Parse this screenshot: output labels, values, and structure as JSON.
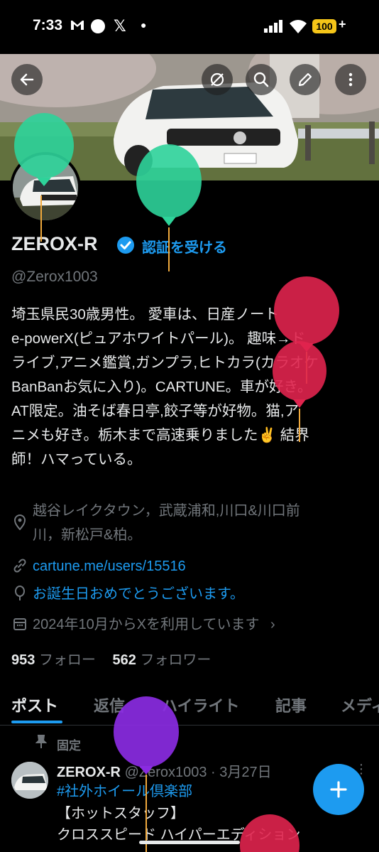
{
  "status_bar": {
    "time": "7:33",
    "battery": "100",
    "battery_plus": "+"
  },
  "profile": {
    "name": "ZEROX-R",
    "verify_cta": "認証を受ける",
    "handle": "@Zerox1003",
    "bio_lines": [
      "埼玉県民30歳男性。 愛車は、日産ノート",
      "e-powerX(ピュアホワイトパール)。 趣味→ド",
      "ライブ,アニメ鑑賞,ガンプラ,ヒトカラ(カラオケ",
      "BanBanお気に入り)。CARTUNE。車が好き。",
      "AT限定。油そば春日亭,餃子等が好物。猫,ア",
      "ニメも好き。栃木まで高速乗りました✌️ 結界",
      "師！ハマっている。"
    ],
    "location_lines": [
      "越谷レイクタウン，武蔵浦和,川口&川口前",
      "川，新松戸&柏。"
    ],
    "link": "cartune.me/users/15516",
    "birthday": "お誕生日おめでとうございます。",
    "joined": "2024年10月からXを利用しています",
    "following_count": "953",
    "following_label": "フォロー",
    "followers_count": "562",
    "followers_label": "フォロワー"
  },
  "tabs": [
    "ポスト",
    "返信",
    "ハイライト",
    "記事",
    "メディ"
  ],
  "pinned_post": {
    "pinned_label": "固定",
    "author": "ZEROX-R",
    "handle_date": "@Zerox1003 · 3月27日",
    "lines": [
      "#社外ホイール倶楽部",
      "【ホットスタッフ】",
      "クロススピード ハイパーエディション"
    ]
  },
  "colors": {
    "accent": "#1d9bf0",
    "background": "#000000",
    "muted": "#71767b",
    "balloon_green": "#2ed39a",
    "balloon_red": "#e0244e",
    "balloon_purple": "#8a2be2"
  },
  "icons": [
    "back-arrow-icon",
    "no-notification-icon",
    "search-icon",
    "edit-pencil-icon",
    "more-vertical-icon",
    "verified-badge-icon",
    "location-pin-icon",
    "link-icon",
    "birthday-balloon-icon",
    "calendar-icon",
    "chevron-right-icon",
    "pin-icon",
    "plus-icon"
  ]
}
